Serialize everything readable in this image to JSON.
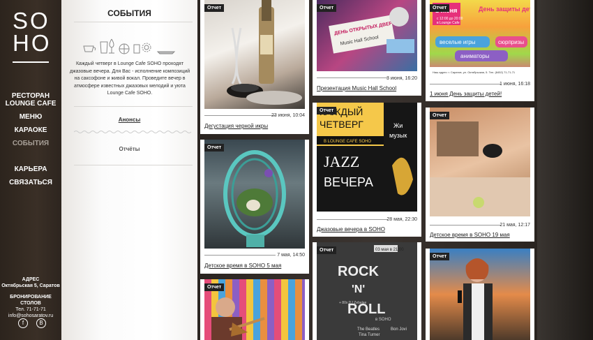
{
  "logo": {
    "line1": "SO",
    "line2": "HO"
  },
  "nav": [
    {
      "label": "РЕСТОРАН LOUNGE CAFE",
      "active": false
    },
    {
      "label": "МЕНЮ",
      "active": false
    },
    {
      "label": "КАРАОКЕ",
      "active": false
    },
    {
      "label": "СОБЫТИЯ",
      "active": true
    },
    {
      "label": "КАРЬЕРА",
      "active": false
    },
    {
      "label": "СВЯЗАТЬСЯ",
      "active": false
    }
  ],
  "contact": {
    "address_heading": "АДРЕС",
    "address": "Октябрьская 5, Саратов",
    "booking_heading": "БРОНИРОВАНИЕ СТОЛОВ",
    "phone": "Тел. 71-71-71",
    "email": "info@sohosaratov.ru"
  },
  "panel": {
    "title": "СОБЫТИЯ",
    "description": "Каждый четверг в Lounge Cafe SOHO проходят джазовые вечера. Для Вас - исполнение композиций на саксофоне и живой вокал. Проведите вечер в атмосфере известных джазовых мелодий и уюта Lounge Cafe SOHO.",
    "link_announcements": "Анонсы",
    "link_reports": "Отчёты"
  },
  "cards": [
    {
      "tag": "Отчет",
      "date": "23 июня, 10:04",
      "title": "Дегустация черной икры"
    },
    {
      "tag": "Отчет",
      "date": "7 мая, 14:50",
      "title": "Детское время в SOHO 5 мая"
    },
    {
      "tag": "Отчет"
    },
    {
      "tag": "Отчет",
      "date": "3 июня, 16:20",
      "title": "Презентация Music Hall School",
      "image_text": [
        "ДЕНЬ ОТКРЫТЫХ ДВЕРЕЙ",
        "Music Hall School"
      ]
    },
    {
      "tag": "Отчет",
      "date": "28 мая, 22:30",
      "title": "Джазовые вечера в SOHO",
      "image_text": [
        "КАЖДЫЙ",
        "ЧЕТВЕРГ",
        "В LOUNGE CAFE SOHO",
        "JAZZ",
        "ВЕЧЕРА",
        "Жи",
        "музык"
      ]
    },
    {
      "tag": "Отчет",
      "image_text": [
        "03 мая в 21:00",
        "ROCK",
        "'N'",
        "ROLL",
        "в SOHO",
        "+ 80x DJ Zebelee",
        "The Beatles",
        "Bon Jovi",
        "Tina Turner"
      ]
    },
    {
      "tag": "Отчет",
      "date": "1 июня, 16:18",
      "title": "1 июня День защиты детей!",
      "image_text": [
        "1 июня",
        "День защиты детей!",
        "с 12:00 до 20:00",
        "в Lounge Cafe",
        "веселые игры",
        "сюрпризы",
        "аниматоры",
        "Наш адрес: г. Саратов, ул. Октябрьская, 5. Тел. (8452) 71-71-71"
      ]
    },
    {
      "tag": "Отчет",
      "date": "21 мая, 12:17",
      "title": "Детское время в SOHO 19 мая"
    },
    {
      "tag": "Отчет"
    }
  ]
}
